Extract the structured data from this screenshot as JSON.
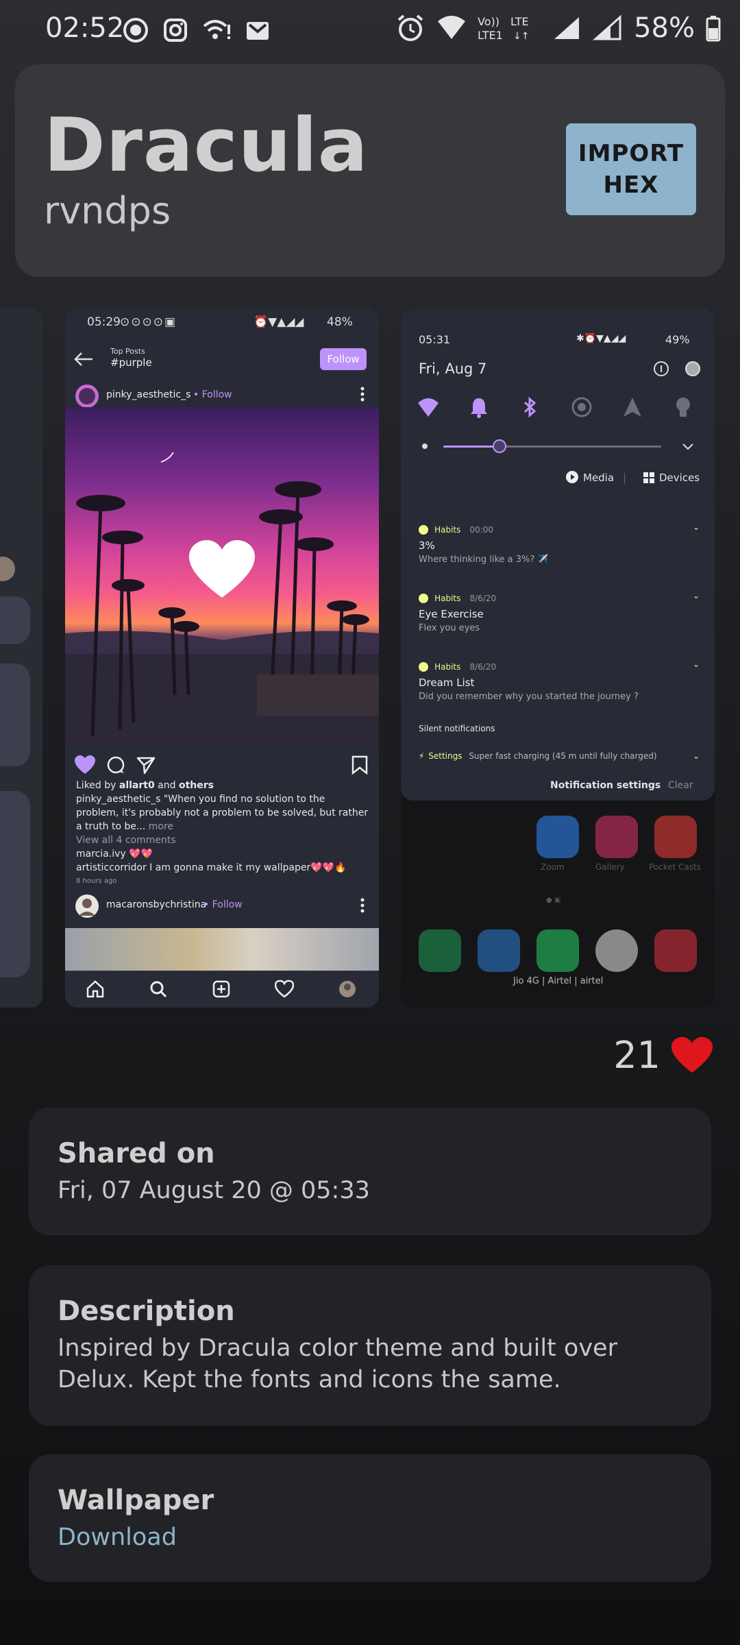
{
  "status_bar": {
    "time": "02:52",
    "battery": "58%"
  },
  "theme": {
    "title": "Dracula",
    "author": "rvndps",
    "import_button": "IMPORT\nHEX"
  },
  "preview1": {
    "status_time": "05:29",
    "status_battery": "48%",
    "top_posts_label": "Top Posts",
    "hashtag": "#purple",
    "follow_button": "Follow",
    "post_user": "pinky_aesthetic_s",
    "post_user_follow": "• Follow",
    "liked_by_prefix": "Liked by",
    "liked_by_user": "allart0",
    "liked_by_and": "and",
    "liked_by_others": "others",
    "caption_user": "pinky_aesthetic_s",
    "caption_text": "\"When you find no solution to the problem, it's probably not a problem to be solved, but rather a truth to be...",
    "caption_more": "more",
    "view_comments": "View all 4 comments",
    "comment1_user": "marcia.ivy",
    "comment1_text": "💖💖",
    "comment2_user": "artisticcorridor",
    "comment2_text": "I am gonna make it my wallpaper💖💖🔥",
    "time_ago": "8 hours ago",
    "next_user": "macaronsbychristina",
    "next_follow": "• Follow"
  },
  "preview2": {
    "status_time": "05:31",
    "status_battery": "49%",
    "date": "Fri, Aug 7",
    "media_label": "Media",
    "devices_label": "Devices",
    "notifications": [
      {
        "app": "Habits",
        "time": "00:00",
        "title": "3%",
        "body": "Where thinking like a 3%? ✈️"
      },
      {
        "app": "Habits",
        "time": "8/6/20",
        "title": "Eye Exercise",
        "body": "Flex you eyes"
      },
      {
        "app": "Habits",
        "time": "8/6/20",
        "title": "Dream List",
        "body": "Did you remember why you started the journey ?"
      }
    ],
    "silent_label": "Silent notifications",
    "settings_app": "Settings",
    "settings_text": "Super fast charging (45 m until fully charged)",
    "notif_settings": "Notification settings",
    "clear": "Clear",
    "home_apps": [
      "Zoom",
      "Gallery",
      "Pocket Casts"
    ],
    "carrier": "Jio 4G | Airtel | airtel"
  },
  "likes": {
    "count": "21"
  },
  "shared": {
    "title": "Shared on",
    "value": "Fri, 07 August 20 @ 05:33"
  },
  "description": {
    "title": "Description",
    "value": "Inspired by Dracula color theme and built over Delux. Kept the fonts and icons the same."
  },
  "wallpaper": {
    "title": "Wallpaper",
    "link": "Download"
  },
  "colors": {
    "accent": "#bd93f9",
    "button": "#8fb3cc",
    "card": "#222326",
    "heart": "#e0161d"
  }
}
